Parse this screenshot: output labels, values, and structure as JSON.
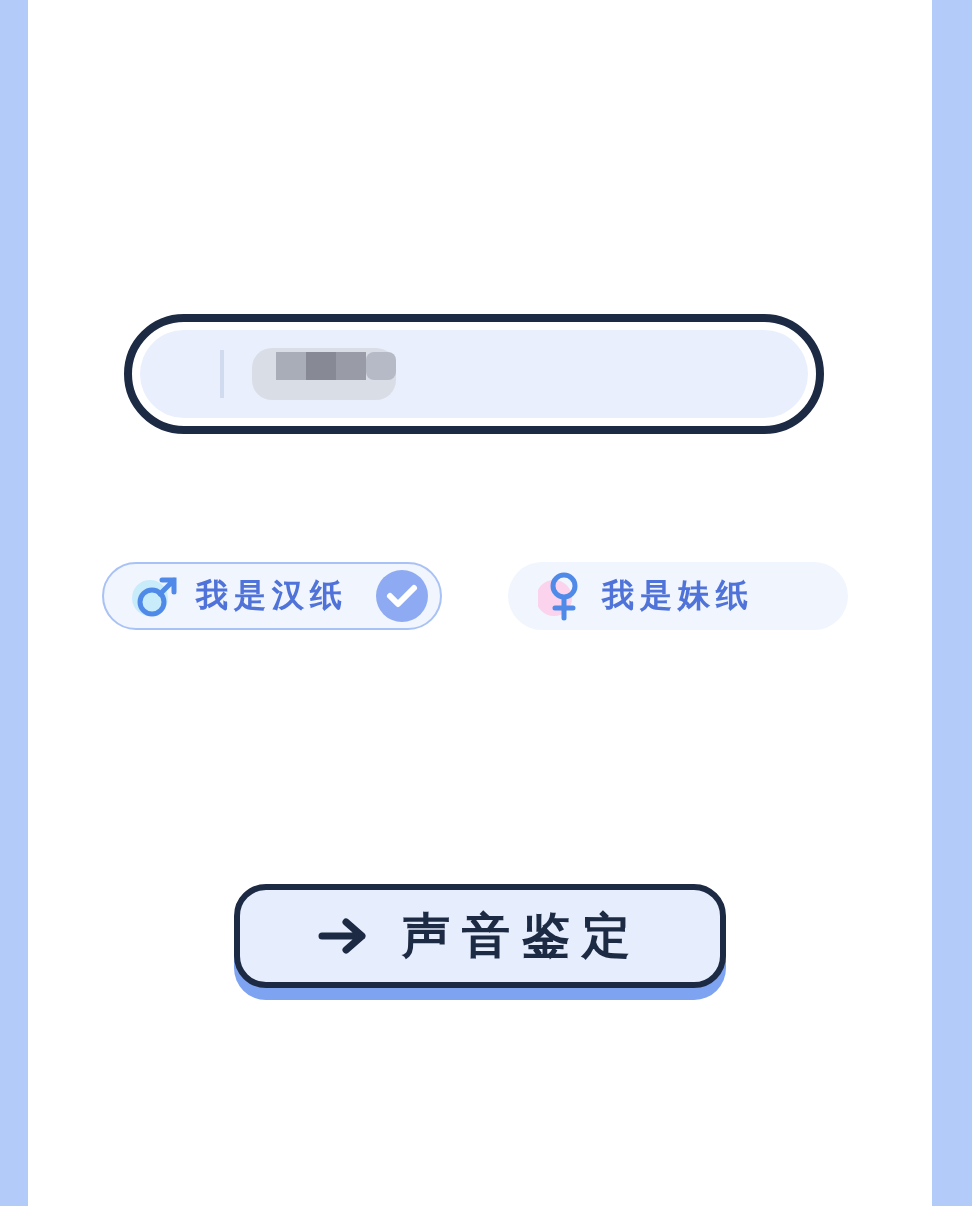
{
  "gender_options": [
    {
      "label": "我是汉纸",
      "kind": "male",
      "selected": true
    },
    {
      "label": "我是妹纸",
      "kind": "female",
      "selected": false
    }
  ],
  "submit_button": {
    "label": "声音鉴定"
  }
}
